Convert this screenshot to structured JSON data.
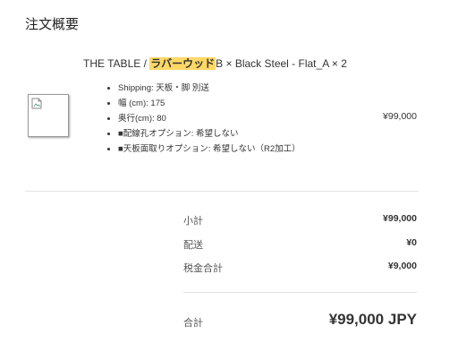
{
  "page": {
    "title": "注文概要"
  },
  "item": {
    "name_prefix": "THE TABLE / ",
    "name_highlight": "ラバーウッド",
    "name_suffix": "B × Black Steel - Flat_A × 2",
    "thumbnail_icon": "broken-image-icon",
    "specs": [
      "Shipping: 天板・脚 別送",
      "幅 (cm): 175",
      "奥行(cm): 80",
      "■配線孔オプション: 希望しない",
      "■天板面取りオプション: 希望しない（R2加工）"
    ],
    "price": "¥99,000"
  },
  "summary": {
    "subtotal_label": "小計",
    "subtotal_value": "¥99,000",
    "shipping_label": "配送",
    "shipping_value": "¥0",
    "tax_label": "税金合計",
    "tax_value": "¥9,000",
    "total_label": "合計",
    "total_value": "¥99,000 JPY"
  },
  "colors": {
    "highlight": "#ffd866"
  }
}
